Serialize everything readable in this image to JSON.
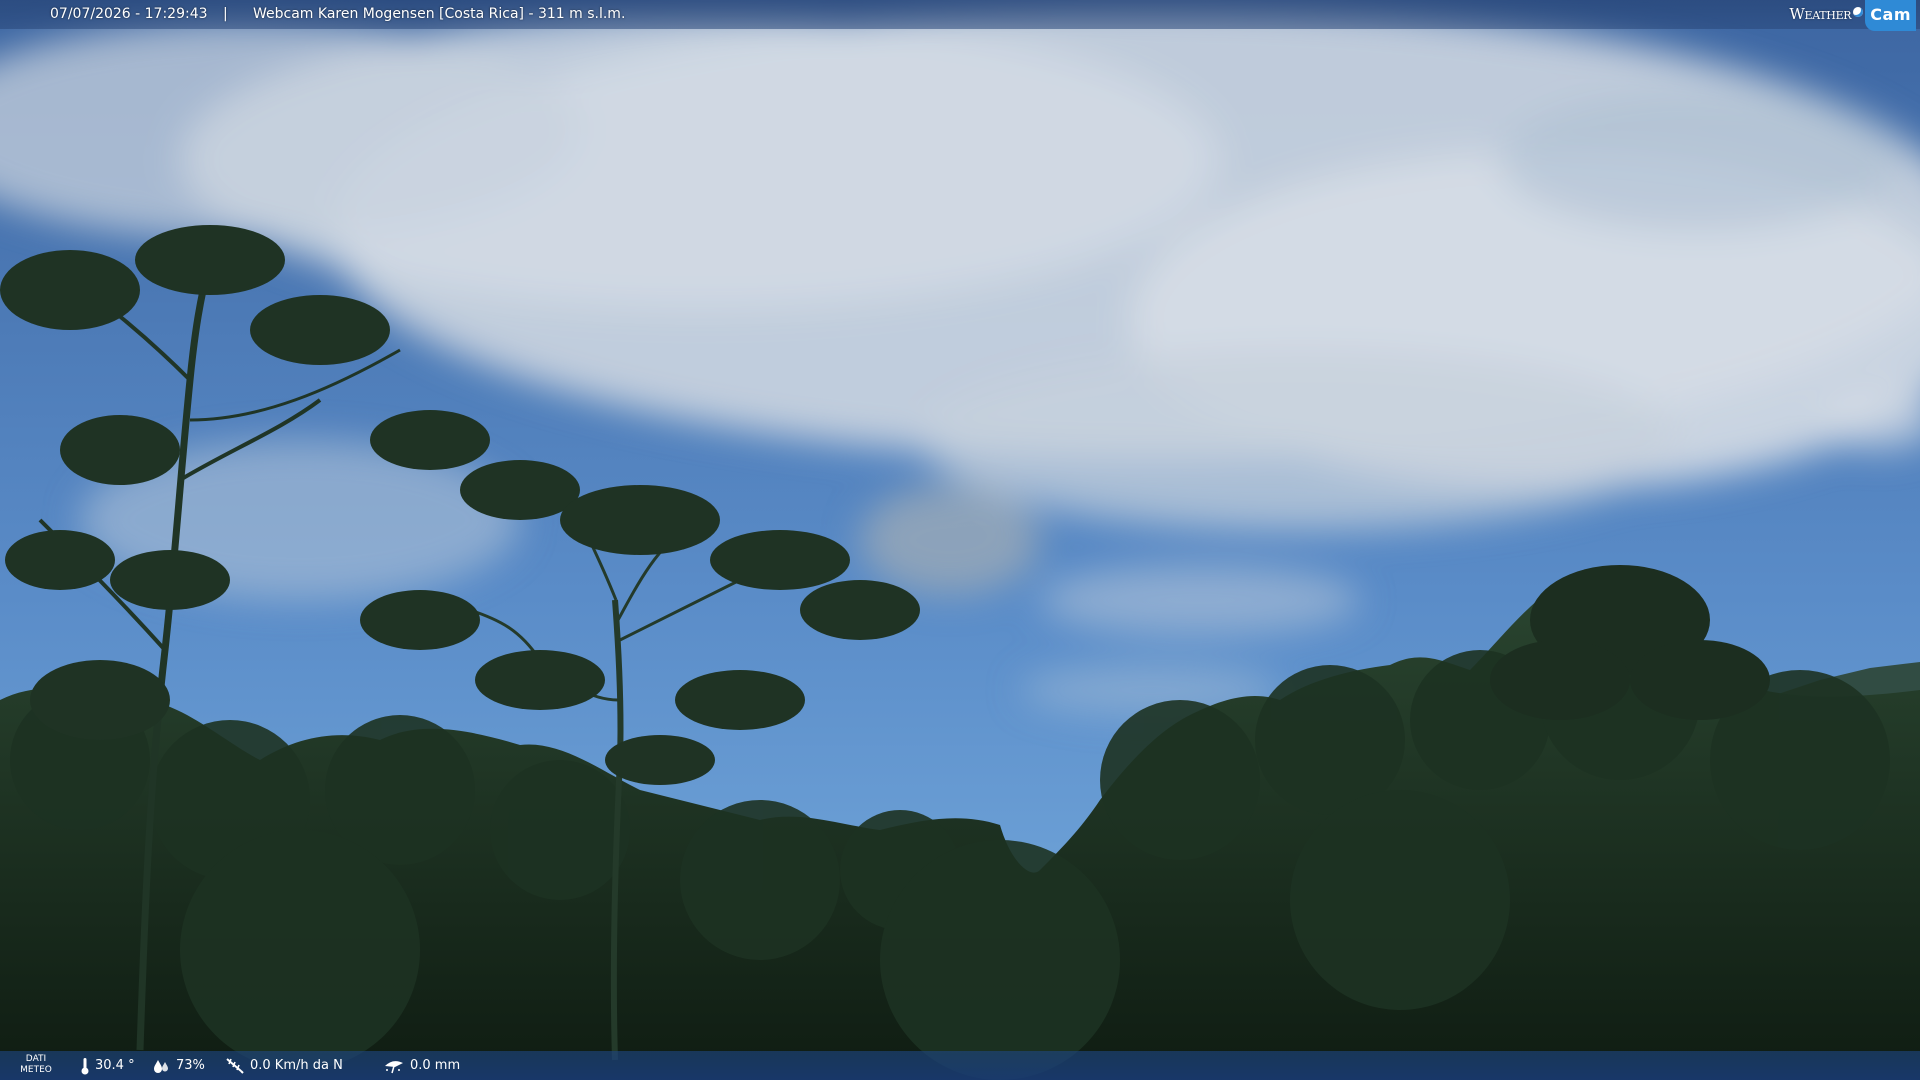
{
  "overlay": {
    "timestamp": "07/07/2026 - 17:29:43",
    "separator": "|",
    "title": "Webcam Karen Mogensen [Costa Rica] - 311 m s.l.m.",
    "brand_word": "Weather",
    "brand_cam": "Cam"
  },
  "weather": {
    "label_line1": "DATI",
    "label_line2": "METEO",
    "temperature": "30.4 °",
    "humidity": "73%",
    "wind": "0.0 Km/h da N",
    "rain": "0.0 mm",
    "icons": [
      "thermometer-icon",
      "humidity-icon",
      "wind-icon",
      "rain-icon"
    ]
  },
  "colors": {
    "sky_top": "#3f6aa6",
    "sky_horizon": "#6aa0d8",
    "cloud": "#cfd8e2",
    "foliage_dark": "#16261a",
    "foliage_mid": "#25402a",
    "bar_bg": "#2a4f86"
  }
}
